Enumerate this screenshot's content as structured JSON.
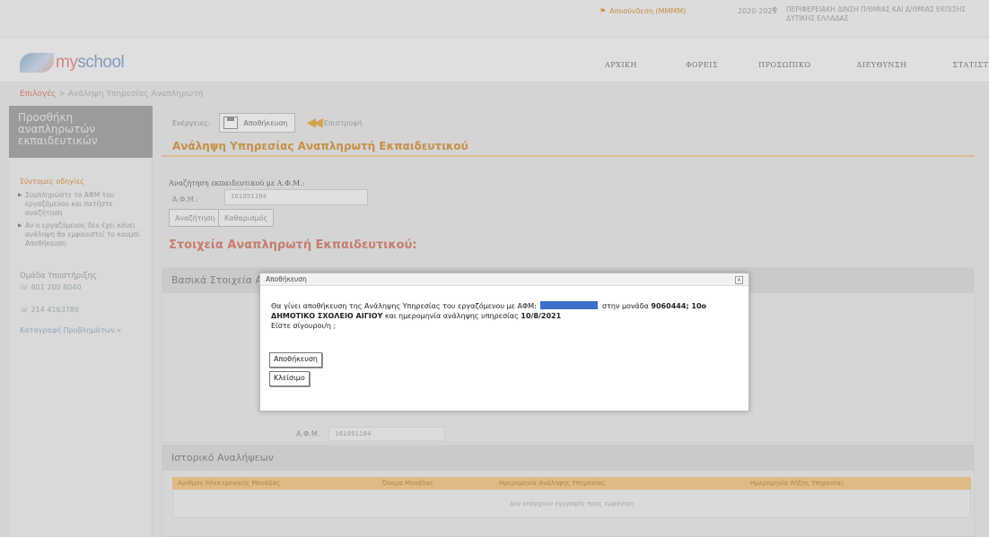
{
  "topbar": {
    "user": "Αποσύνδεση (ΜΜΜΜ)",
    "year": "2020-2021",
    "region": "ΠΕΡΙΦΕΡΕΙΑΚΗ ΔΙΝΣΗ Π/ΘΜΙΑΣ ΚΑΙ Δ/ΘΜΙΑΣ ΕΚΠ/ΣΗΣ ΔΥΤΙΚΗΣ ΕΛΛΑΔΑΣ"
  },
  "header": {
    "logo_my": "my",
    "logo_school": "school",
    "nav": [
      "ΑΡΧΙΚΗ",
      "ΦΟΡΕΙΣ",
      "ΠΡΟΣΩΠΙΚΟ",
      "ΔΙΕΥΘΥΝΣΗ",
      "ΣΤΑΤΙΣΤΙΚΑ"
    ]
  },
  "breadcrumb": {
    "first": "Επιλογές",
    "sep": ">",
    "current": "Ανάληψη Υπηρεσίας Αναπληρωτή"
  },
  "sidebar": {
    "title": "Προσθήκη αναπληρωτών εκπαιδευτικών",
    "guide_title": "Σύντομες οδηγίες",
    "guide": [
      "Συμπληρώστε το ΑΦΜ του εργαζόμενου και πατήστε αναζήτηση",
      "Αν ο εργαζόμενος δεν έχει κάνει ανάληψη θα εμφανιστεί το κουμπί Αποθήκευση"
    ],
    "support_title": "Ομάδα Υποστήριξης",
    "phones": [
      "801 200 8040",
      "214 4163789"
    ],
    "issues_link": "Καταγραφή Προβλημάτων »"
  },
  "main": {
    "actions_label": "Ενέργειες:",
    "save_label": "Αποθήκευση",
    "back_label": "Επιστροφή",
    "page_title": "Ανάληψη Υπηρεσίας Αναπληρωτή Εκπαιδευτικού",
    "search_label": "Αναζήτηση εκπαιδευτικού με Α.Φ.Μ.:",
    "afm_label": "Α.Φ.Μ.:",
    "afm_value": "161951184",
    "search_btn": "Αναζήτηση",
    "clear_btn": "Καθαρισμός",
    "section_title": "Στοιχεία Αναπληρωτή Εκπαιδευτικού:",
    "basic_panel_title": "Βασικά Στοιχεία Α",
    "afm_row_label": "Α.Φ.Μ.",
    "afm_row_value": "161951184",
    "history_title": "Ιστορικό Αναλήψεων",
    "history_columns": [
      "Αριθμός Ηλεκτρονικής Μονάδας",
      "Όνομα Μονάδας",
      "Ημερομηνία Ανάληψης Υπηρεσίας",
      "Ημερομηνία Λήξης Υπηρεσίας"
    ],
    "history_empty": "Δεν υπάρχουν εγγραφές προς εμφάνιση"
  },
  "modal": {
    "title": "Αποθήκευση",
    "close": "x",
    "text_before": "Θα γίνει αποθήκευση της Ανάληψης Υπηρεσίας του εργαζόμενου με ΑΦΜ:",
    "text_unit": "στην μονάδα",
    "unit_code": "9060444; 10ο",
    "unit_name": "ΔΗΜΟΤΙΚΟ ΣΧΟΛΕΙΟ ΑΙΓΙΟΥ",
    "text_date": "και ημερομηνία ανάληψης υπηρεσίας",
    "date": "10/8/2021",
    "confirm": "Είστε σίγουροι/η ;",
    "save_btn": "Αποθήκευση",
    "close_btn": "Κλείσιμο",
    "redact_color": "#3b6fc9"
  }
}
